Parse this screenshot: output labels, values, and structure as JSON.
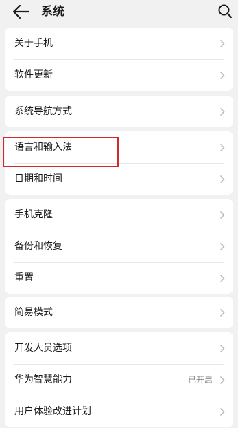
{
  "header": {
    "title": "系统",
    "back_icon": "arrow-left-icon",
    "search_icon": "search-icon"
  },
  "groups": [
    {
      "items": [
        {
          "label": "关于手机"
        },
        {
          "label": "软件更新"
        }
      ]
    },
    {
      "items": [
        {
          "label": "系统导航方式"
        }
      ]
    },
    {
      "items": [
        {
          "label": "语言和输入法",
          "highlighted": true
        },
        {
          "label": "日期和时间"
        }
      ]
    },
    {
      "items": [
        {
          "label": "手机克隆"
        },
        {
          "label": "备份和恢复"
        },
        {
          "label": "重置"
        }
      ]
    },
    {
      "items": [
        {
          "label": "简易模式"
        }
      ]
    },
    {
      "items": [
        {
          "label": "开发人员选项"
        },
        {
          "label": "华为智慧能力",
          "value": "已开启"
        },
        {
          "label": "用户体验改进计划"
        }
      ]
    }
  ],
  "colors": {
    "background": "#f1f1f1",
    "card": "#ffffff",
    "highlight": "#d62828",
    "secondary_text": "#8a8a8a",
    "chevron": "#b8b8b8"
  }
}
